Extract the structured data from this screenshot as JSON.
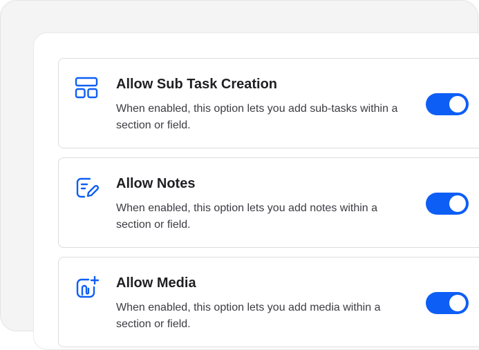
{
  "settings": [
    {
      "icon": "layout-grid-icon",
      "title": "Allow Sub Task Creation",
      "description": "When enabled, this option lets you add sub-tasks within a section or field.",
      "enabled": true
    },
    {
      "icon": "note-edit-icon",
      "title": "Allow Notes",
      "description": "When enabled, this option lets you add notes within a section or field.",
      "enabled": true
    },
    {
      "icon": "attachment-add-icon",
      "title": "Allow Media",
      "description": "When enabled, this option lets you add media within a section or field.",
      "enabled": true
    }
  ],
  "colors": {
    "accent": "#0d5ef5",
    "title_text": "#1f1f23",
    "body_text": "#3b3b42",
    "card_border": "#dcdce0",
    "frame_bg": "#f4f4f5"
  }
}
